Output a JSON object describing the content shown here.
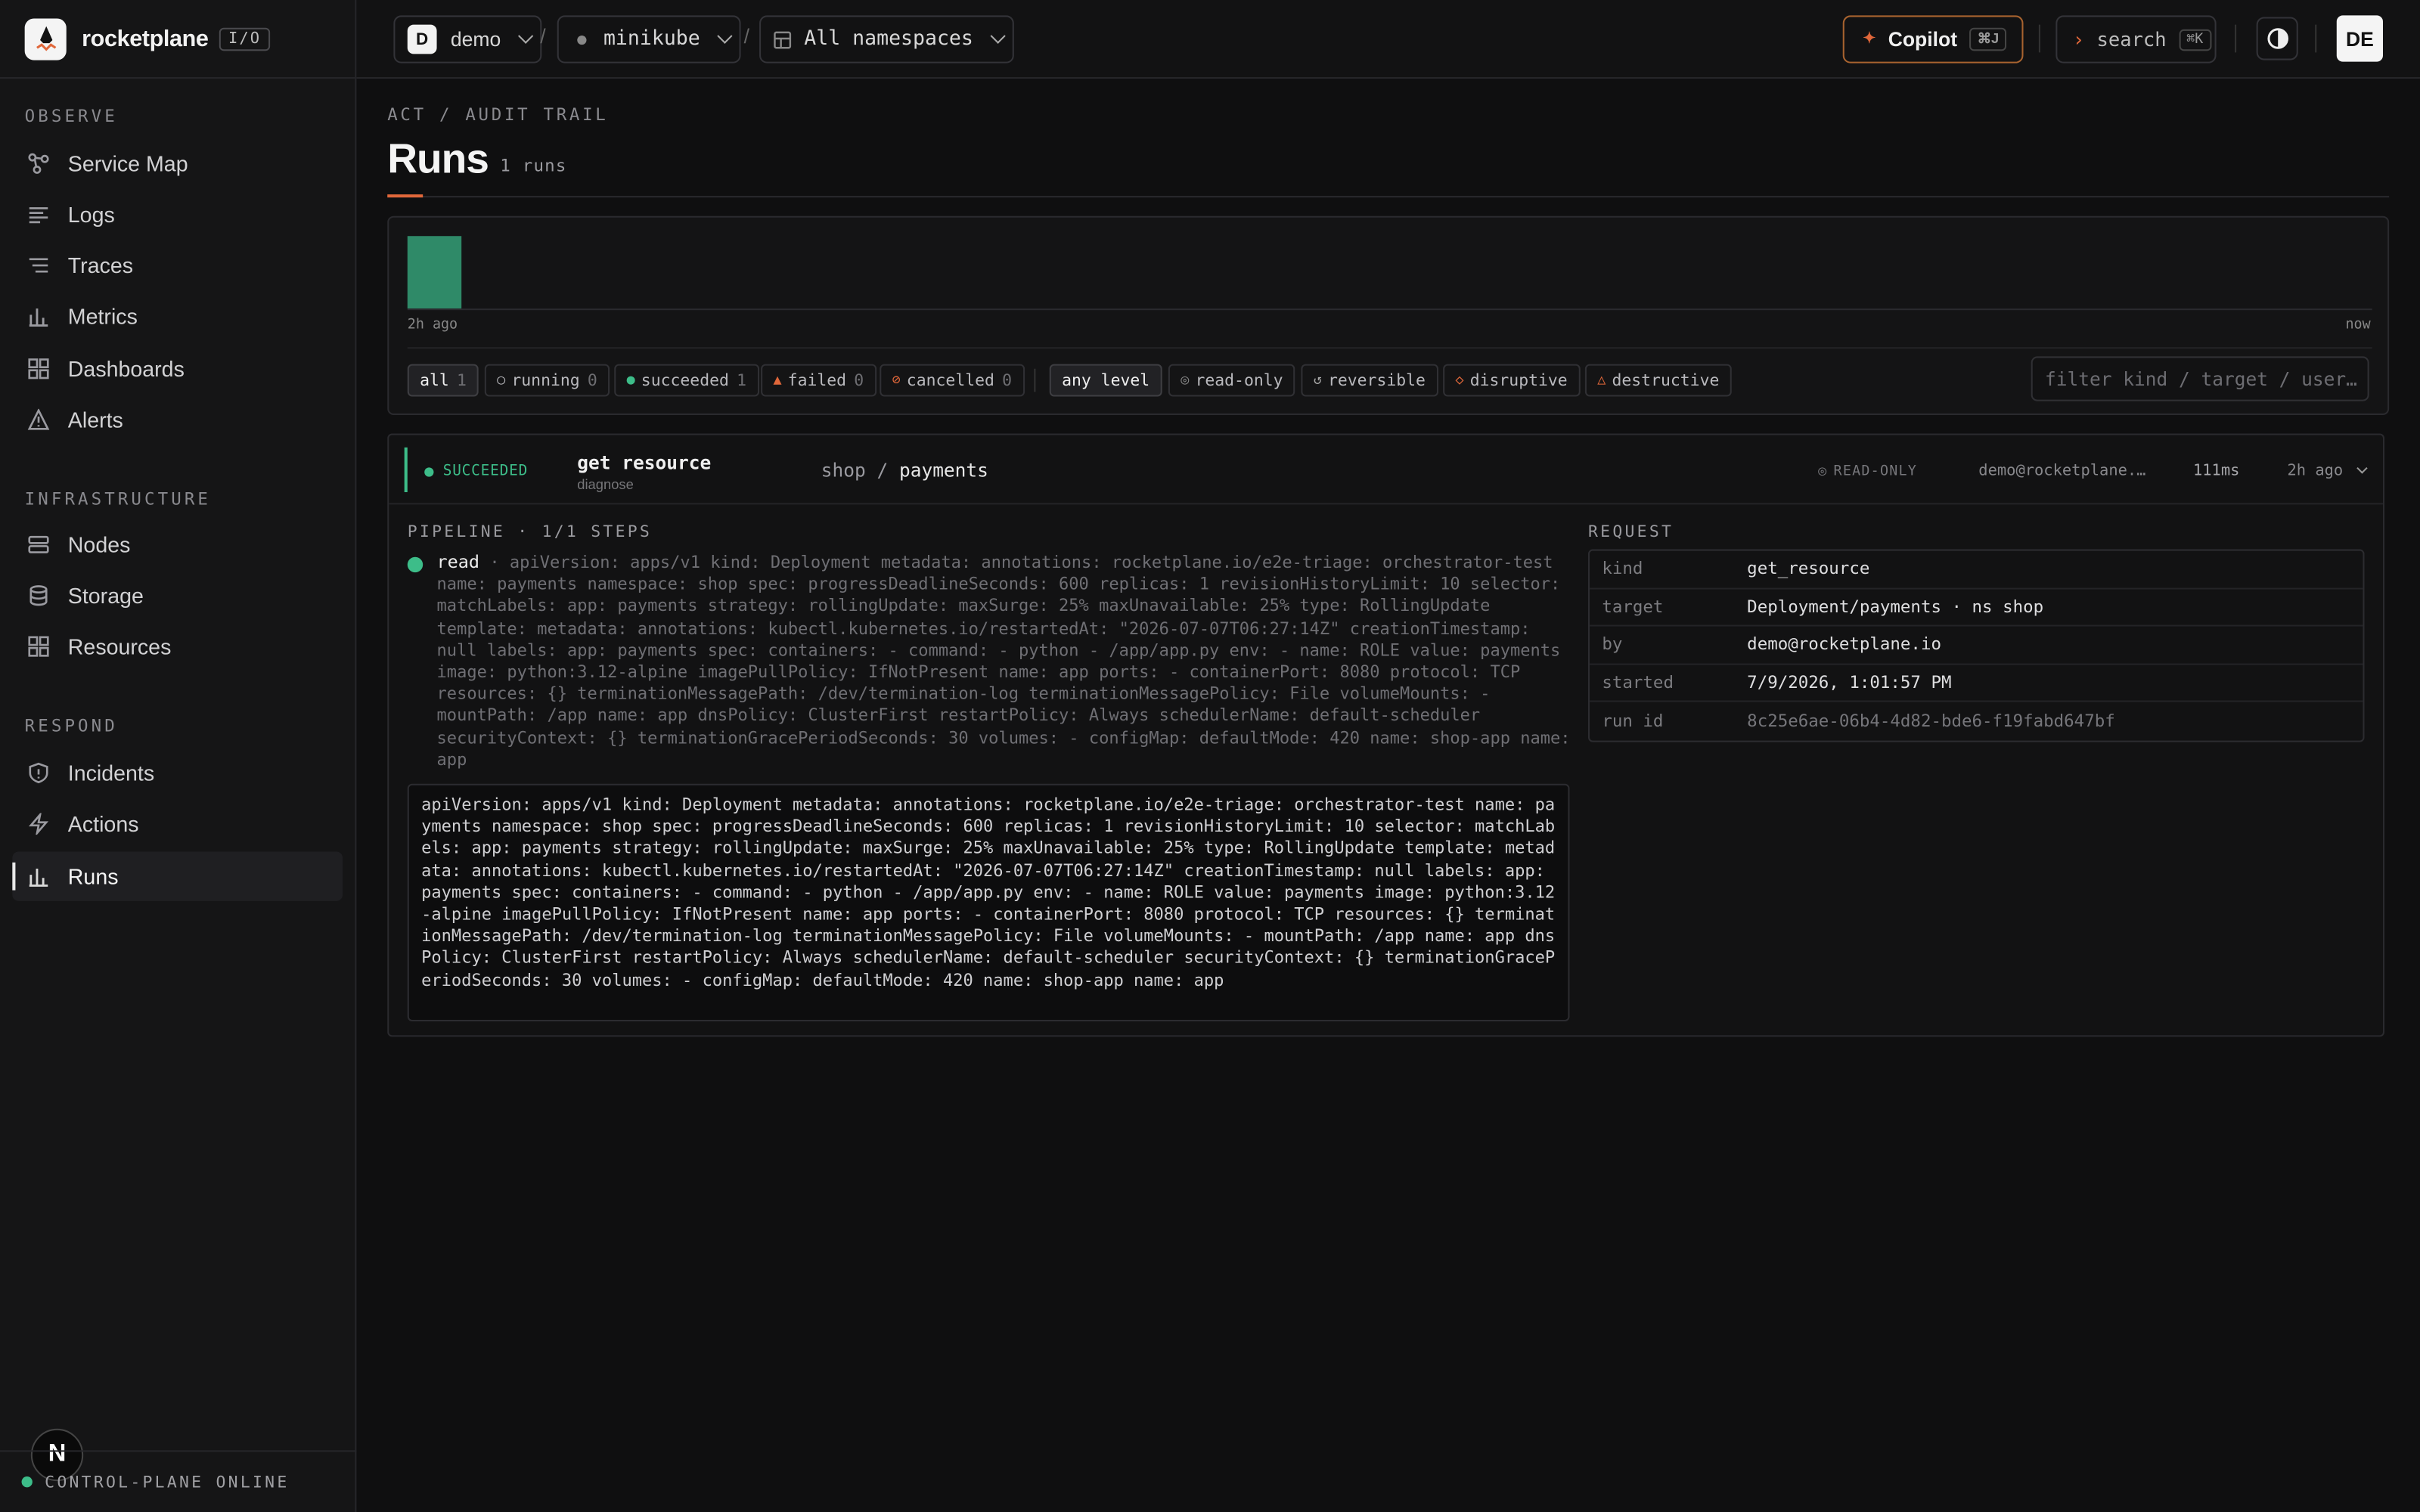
{
  "brand": {
    "name": "rocketplane",
    "tag": "I/O"
  },
  "sidebar": {
    "sections": [
      {
        "label": "OBSERVE",
        "items": [
          {
            "label": "Service Map",
            "icon": "service-map-icon"
          },
          {
            "label": "Logs",
            "icon": "logs-icon"
          },
          {
            "label": "Traces",
            "icon": "traces-icon"
          },
          {
            "label": "Metrics",
            "icon": "metrics-icon"
          },
          {
            "label": "Dashboards",
            "icon": "dashboards-icon"
          },
          {
            "label": "Alerts",
            "icon": "alert-icon"
          }
        ]
      },
      {
        "label": "INFRASTRUCTURE",
        "items": [
          {
            "label": "Nodes",
            "icon": "nodes-icon"
          },
          {
            "label": "Storage",
            "icon": "storage-icon"
          },
          {
            "label": "Resources",
            "icon": "resources-icon"
          }
        ]
      },
      {
        "label": "RESPOND",
        "items": [
          {
            "label": "Incidents",
            "icon": "shield-icon"
          },
          {
            "label": "Actions",
            "icon": "bolt-icon"
          },
          {
            "label": "Runs",
            "icon": "bar-chart-icon",
            "active": true
          }
        ]
      }
    ],
    "status": "CONTROL-PLANE ONLINE",
    "badge": "N"
  },
  "topbar": {
    "workspace_initial": "D",
    "workspace": "demo",
    "cluster": "minikube",
    "namespace": "All namespaces",
    "copilot_label": "Copilot",
    "copilot_kbd": "⌘J",
    "search_label": "search",
    "search_kbd": "⌘K",
    "user_initials": "DE"
  },
  "page": {
    "breadcrumb": "ACT / AUDIT TRAIL",
    "title": "Runs",
    "count": "1 runs"
  },
  "histogram": {
    "left_label": "2h ago",
    "right_label": "now",
    "bar_fraction": 1.0
  },
  "status_filters": [
    {
      "label": "all",
      "count": "1",
      "selected": true,
      "icon": ""
    },
    {
      "label": "running",
      "count": "0",
      "icon": "○"
    },
    {
      "label": "succeeded",
      "count": "1",
      "icon": "●"
    },
    {
      "label": "failed",
      "count": "0",
      "icon": "▲"
    },
    {
      "label": "cancelled",
      "count": "0",
      "icon": "⊘"
    }
  ],
  "level_filters": [
    {
      "label": "any level",
      "selected": true,
      "icon": ""
    },
    {
      "label": "read-only",
      "icon": "◎"
    },
    {
      "label": "reversible",
      "icon": "↺"
    },
    {
      "label": "disruptive",
      "icon": "◇"
    },
    {
      "label": "destructive",
      "icon": "△"
    }
  ],
  "filter_placeholder": "filter kind / target / user…",
  "run": {
    "status": "SUCCEEDED",
    "name": "get resource",
    "sub": "diagnose",
    "namespace": "shop",
    "target": "payments",
    "level": "READ-ONLY",
    "user": "demo@rocketplane.…",
    "duration": "111ms",
    "ago": "2h ago",
    "pipeline_label": "PIPELINE · 1/1 STEPS",
    "step_verb": "read",
    "step_text": "· apiVersion: apps/v1 kind: Deployment metadata: annotations: rocketplane.io/e2e-triage: orchestrator-test name: payments namespace: shop spec: progressDeadlineSeconds: 600 replicas: 1 revisionHistoryLimit: 10 selector: matchLabels: app: payments strategy: rollingUpdate: maxSurge: 25% maxUnavailable: 25% type: RollingUpdate template: metadata: annotations: kubectl.kubernetes.io/restartedAt: \"2026-07-07T06:27:14Z\" creationTimestamp: null labels: app: payments spec: containers: - command: - python - /app/app.py env: - name: ROLE value: payments image: python:3.12-alpine imagePullPolicy: IfNotPresent name: app ports: - containerPort: 8080 protocol: TCP resources: {} terminationMessagePath: /dev/termination-log terminationMessagePolicy: File volumeMounts: - mountPath: /app name: app dnsPolicy: ClusterFirst restartPolicy: Always schedulerName: default-scheduler securityContext: {} terminationGracePeriodSeconds: 30 volumes: - configMap: defaultMode: 420 name: shop-app name: app",
    "output": "apiVersion: apps/v1 kind: Deployment metadata: annotations: rocketplane.io/e2e-triage: orchestrator-test name: payments namespace: shop spec: progressDeadlineSeconds: 600 replicas: 1 revisionHistoryLimit: 10 selector: matchLabels: app: payments strategy: rollingUpdate: maxSurge: 25% maxUnavailable: 25% type: RollingUpdate template: metadata: annotations: kubectl.kubernetes.io/restartedAt: \"2026-07-07T06:27:14Z\" creationTimestamp: null labels: app: payments spec: containers: - command: - python - /app/app.py env: - name: ROLE value: payments image: python:3.12-alpine imagePullPolicy: IfNotPresent name: app ports: - containerPort: 8080 protocol: TCP resources: {} terminationMessagePath: /dev/termination-log terminationMessagePolicy: File volumeMounts: - mountPath: /app name: app dnsPolicy: ClusterFirst restartPolicy: Always schedulerName: default-scheduler securityContext: {} terminationGracePeriodSeconds: 30 volumes: - configMap: defaultMode: 420 name: shop-app name: app",
    "request_label": "REQUEST",
    "request": [
      {
        "k": "kind",
        "v": "get_resource"
      },
      {
        "k": "target",
        "v": "Deployment/payments · ns shop"
      },
      {
        "k": "by",
        "v": "demo@rocketplane.io"
      },
      {
        "k": "started",
        "v": "7/9/2026, 1:01:57 PM"
      },
      {
        "k": "run id",
        "v": "8c25e6ae-06b4-4d82-bde6-f19fabd647bf",
        "dim": true
      }
    ]
  },
  "colors": {
    "accent": "#e0673a",
    "success": "#3dbd89",
    "copilot_border": "#a8632f"
  }
}
